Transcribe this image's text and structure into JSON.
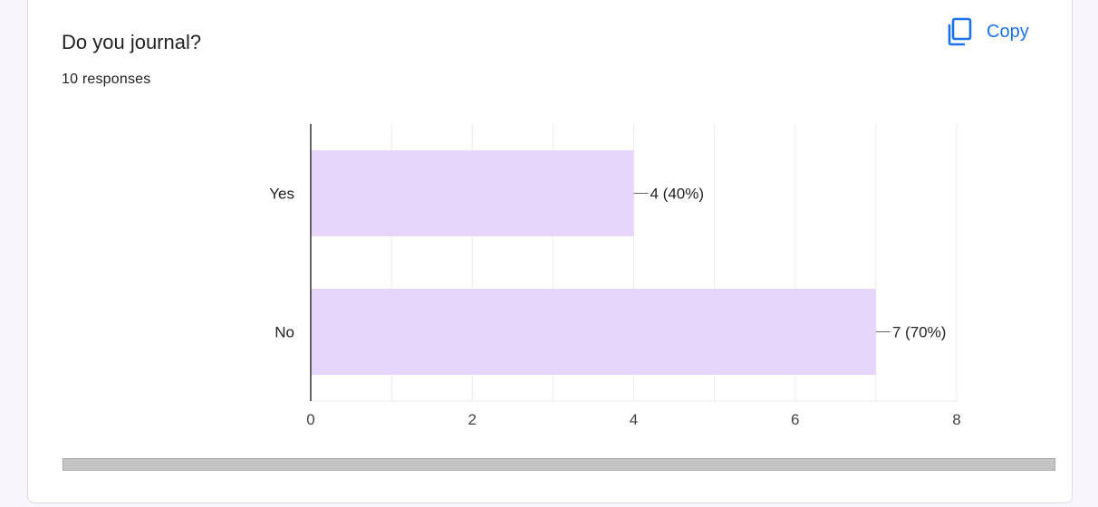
{
  "question": {
    "title": "Do you journal?",
    "responses_label": "10 responses"
  },
  "copy_button": {
    "label": "Copy",
    "icon": "copy-icon",
    "color": "#1a73e8"
  },
  "chart_data": {
    "type": "bar",
    "orientation": "horizontal",
    "categories": [
      "Yes",
      "No"
    ],
    "values": [
      4,
      7
    ],
    "value_labels": [
      "4 (40%)",
      "7 (70%)"
    ],
    "xlim": [
      0,
      8
    ],
    "xticks": [
      0,
      2,
      4,
      6,
      8
    ],
    "grid": true,
    "bar_color": "#e6d6fb"
  }
}
